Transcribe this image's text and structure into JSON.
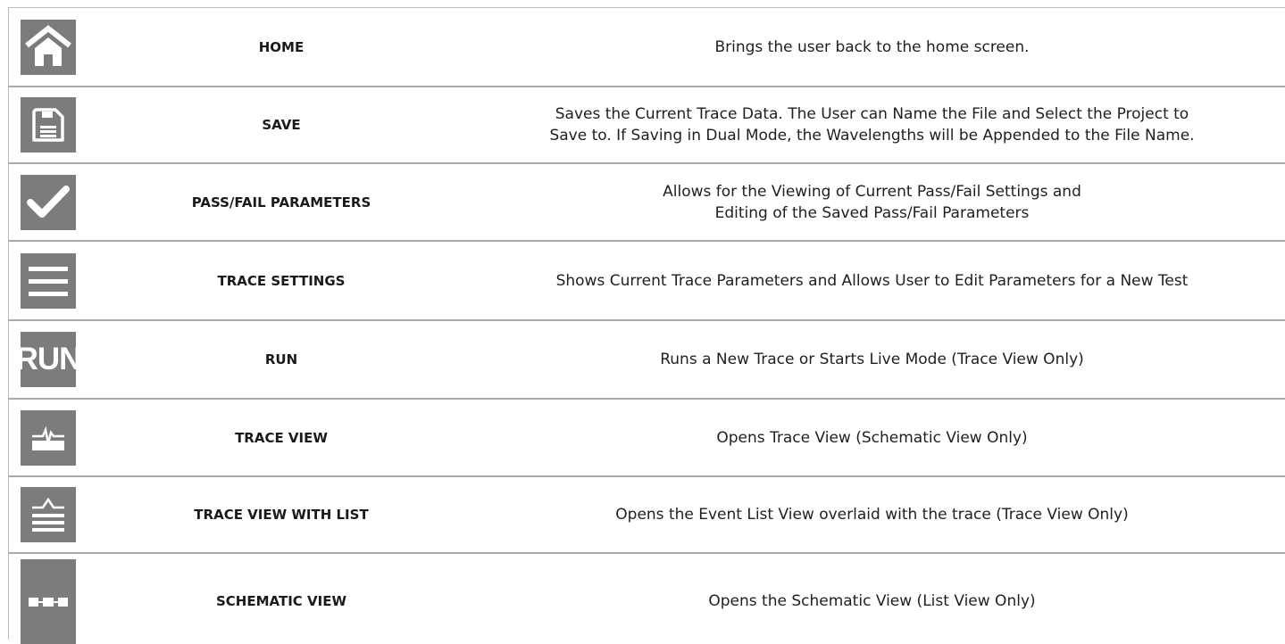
{
  "rows": [
    {
      "icon": "home-icon",
      "name": "HOME",
      "desc": [
        "Brings the user back to the home screen."
      ]
    },
    {
      "icon": "save-icon",
      "name": "SAVE",
      "desc": [
        "Saves the Current Trace Data. The User can Name the File and Select the Project to",
        "Save to. If Saving in Dual Mode, the Wavelengths will be Appended to the File Name."
      ]
    },
    {
      "icon": "checkmark-icon",
      "name": "PASS/FAIL PARAMETERS",
      "desc": [
        "Allows for the Viewing of Current Pass/Fail Settings and",
        "Editing of the Saved Pass/Fail Parameters"
      ]
    },
    {
      "icon": "menu-icon",
      "name": "TRACE SETTINGS",
      "desc": [
        "Shows Current Trace Parameters and Allows User to Edit Parameters for a New Test"
      ]
    },
    {
      "icon": "run-icon",
      "icon_text": "RUN",
      "name": "RUN",
      "desc": [
        "Runs a New Trace or Starts Live Mode (Trace View Only)"
      ]
    },
    {
      "icon": "trace-view-icon",
      "name": "TRACE VIEW",
      "desc": [
        "Opens Trace View (Schematic View Only)"
      ]
    },
    {
      "icon": "trace-list-icon",
      "name": "TRACE VIEW WITH LIST",
      "desc": [
        "Opens the Event List View overlaid with the trace (Trace View Only)"
      ]
    },
    {
      "icon": "schematic-view-icon",
      "name": "SCHEMATIC VIEW",
      "desc": [
        "Opens the Schematic View (List View Only)"
      ]
    }
  ]
}
